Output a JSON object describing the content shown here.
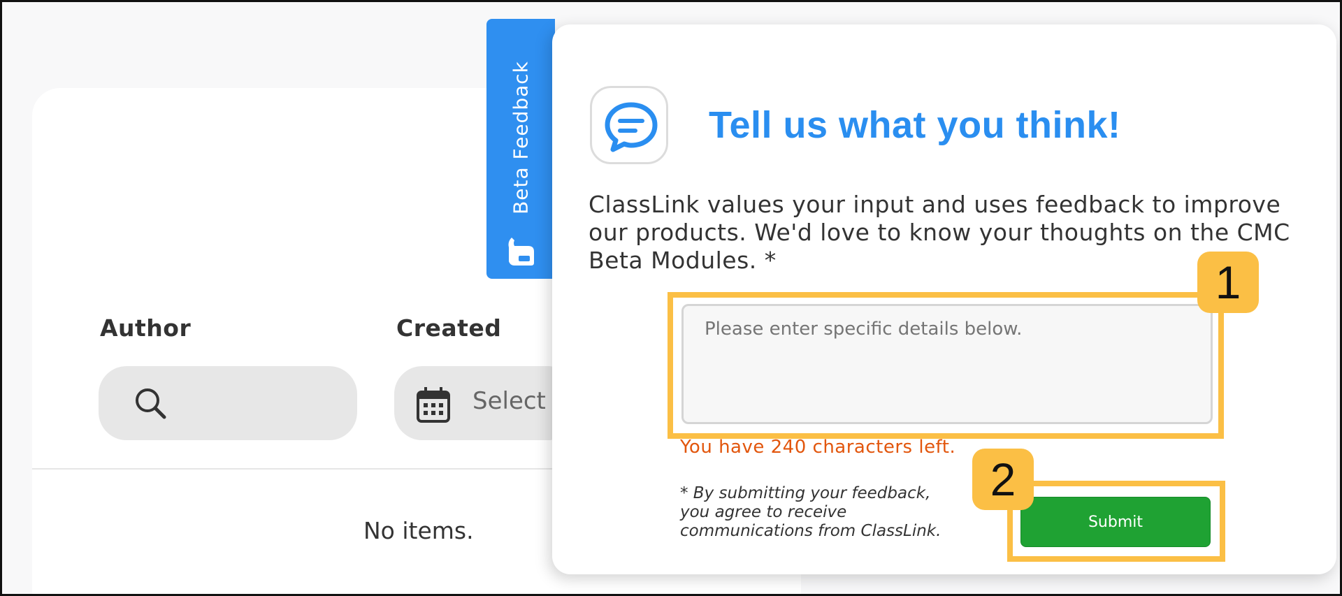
{
  "filters": {
    "author_label": "Author",
    "created_label": "Created",
    "created_placeholder": "Select"
  },
  "list": {
    "empty_text": "No items."
  },
  "beta_tab": {
    "label": "Beta Feedback"
  },
  "feedback": {
    "title": "Tell us what you think!",
    "description": "ClassLink values your input and uses feedback to improve our products. We'd love to know your thoughts on the CMC Beta Modules. *",
    "textarea_placeholder": "Please enter specific details below.",
    "chars_left": "You have 240 characters left.",
    "disclaimer": "* By submitting your feedback, you agree to receive communications from ClassLink.",
    "submit_label": "Submit"
  },
  "annotations": {
    "badge_1": "1",
    "badge_2": "2"
  },
  "colors": {
    "accent_blue": "#2a8ef0",
    "tab_blue": "#2f8ff0",
    "submit_green": "#1fa233",
    "warning_orange": "#e2560d",
    "highlight_yellow": "#fbbf45"
  }
}
